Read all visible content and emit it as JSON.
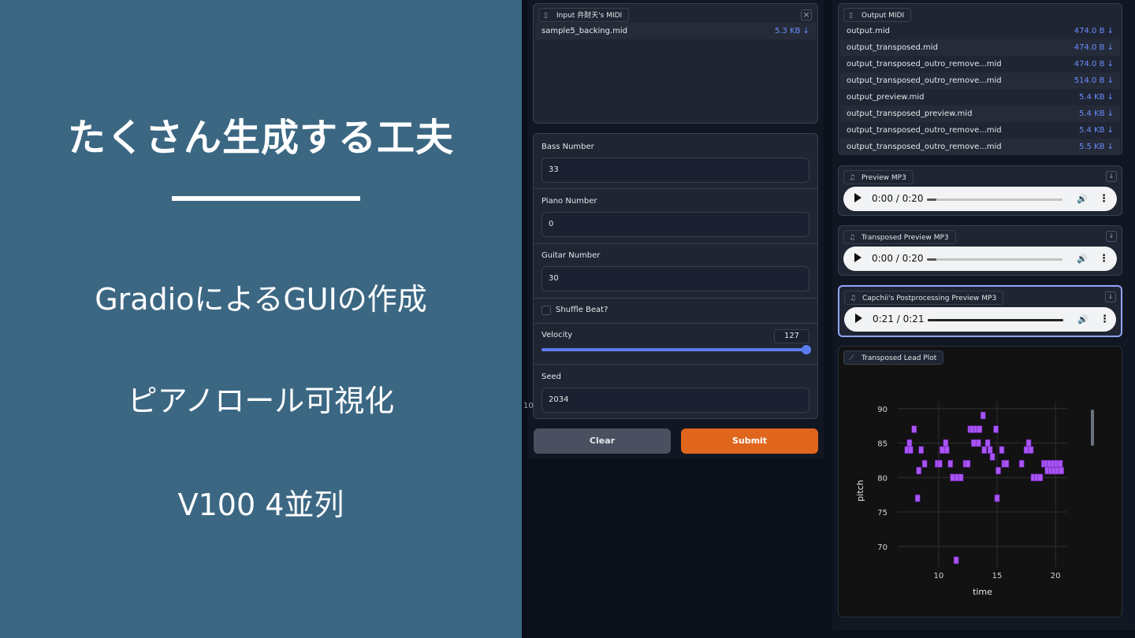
{
  "slide": {
    "title": "たくさん生成する工夫",
    "line1": "GradioによるGUIの作成",
    "line2": "ピアノロール可視化",
    "line3": "V100 4並列"
  },
  "input_midi": {
    "label": "Input 弁財天's MIDI",
    "file_name": "sample5_backing.mid",
    "file_size": "5.3 KB ↓",
    "close_icon": "×"
  },
  "form": {
    "bass": {
      "label": "Bass Number",
      "value": "33"
    },
    "piano": {
      "label": "Piano Number",
      "value": "0"
    },
    "guitar": {
      "label": "Guitar Number",
      "value": "30"
    },
    "shuffle": {
      "label": "Shuffle Beat?",
      "checked": false
    },
    "velocity": {
      "label": "Velocity",
      "value": "127",
      "fraction": 1.0
    },
    "seed": {
      "label": "Seed",
      "value": "2034"
    },
    "stray_number": "10",
    "clear_label": "Clear",
    "submit_label": "Submit"
  },
  "output_midi": {
    "label": "Output MIDI",
    "files": [
      {
        "name": "output.mid",
        "size": "474.0 B ↓"
      },
      {
        "name": "output_transposed.mid",
        "size": "474.0 B ↓"
      },
      {
        "name": "output_transposed_outro_remove...mid",
        "size": "474.0 B ↓"
      },
      {
        "name": "output_transposed_outro_remove...mid",
        "size": "514.0 B ↓"
      },
      {
        "name": "output_preview.mid",
        "size": "5.4 KB ↓"
      },
      {
        "name": "output_transposed_preview.mid",
        "size": "5.4 KB ↓"
      },
      {
        "name": "output_transposed_outro_remove...mid",
        "size": "5.4 KB ↓"
      },
      {
        "name": "output_transposed_outro_remove...mid",
        "size": "5.5 KB ↓"
      }
    ]
  },
  "audio": [
    {
      "label": "Preview MP3",
      "time": "0:00 / 0:20",
      "progress": 0.0,
      "focused": false
    },
    {
      "label": "Transposed Preview MP3",
      "time": "0:00 / 0:20",
      "progress": 0.0,
      "focused": false
    },
    {
      "label": "Capchii's Postprocessing Preview MP3",
      "time": "0:21 / 0:21",
      "progress": 1.0,
      "focused": true
    }
  ],
  "plot_label": "Transposed Lead Plot",
  "colors": {
    "accent": "#6b8cff",
    "submit": "#e0661e",
    "note": "#a855f7",
    "slide_bg": "#3b6783"
  },
  "chart_data": {
    "type": "scatter",
    "title": "",
    "xlabel": "time",
    "ylabel": "pitch",
    "x_ticks": [
      "10",
      "15",
      "20"
    ],
    "y_ticks": [
      "70",
      "75",
      "80",
      "85",
      "90"
    ],
    "xlim": [
      6.5,
      21
    ],
    "ylim": [
      67,
      91
    ],
    "grid": true,
    "notes": [
      {
        "x": 7.3,
        "y": 84
      },
      {
        "x": 7.5,
        "y": 85
      },
      {
        "x": 7.6,
        "y": 84
      },
      {
        "x": 7.9,
        "y": 87
      },
      {
        "x": 8.2,
        "y": 77
      },
      {
        "x": 8.3,
        "y": 81
      },
      {
        "x": 8.5,
        "y": 84
      },
      {
        "x": 8.8,
        "y": 82
      },
      {
        "x": 9.9,
        "y": 82
      },
      {
        "x": 10.1,
        "y": 82
      },
      {
        "x": 10.3,
        "y": 84
      },
      {
        "x": 10.6,
        "y": 85
      },
      {
        "x": 10.7,
        "y": 84
      },
      {
        "x": 11.0,
        "y": 82
      },
      {
        "x": 11.2,
        "y": 80
      },
      {
        "x": 11.5,
        "y": 68
      },
      {
        "x": 11.6,
        "y": 80
      },
      {
        "x": 11.9,
        "y": 80
      },
      {
        "x": 12.3,
        "y": 82
      },
      {
        "x": 12.5,
        "y": 82
      },
      {
        "x": 12.7,
        "y": 87
      },
      {
        "x": 12.9,
        "y": 87
      },
      {
        "x": 13.0,
        "y": 85
      },
      {
        "x": 13.2,
        "y": 87
      },
      {
        "x": 13.4,
        "y": 85
      },
      {
        "x": 13.5,
        "y": 87
      },
      {
        "x": 13.8,
        "y": 89
      },
      {
        "x": 13.9,
        "y": 84
      },
      {
        "x": 14.2,
        "y": 85
      },
      {
        "x": 14.4,
        "y": 84
      },
      {
        "x": 14.6,
        "y": 83
      },
      {
        "x": 14.9,
        "y": 87
      },
      {
        "x": 15.0,
        "y": 77
      },
      {
        "x": 15.1,
        "y": 81
      },
      {
        "x": 15.4,
        "y": 84
      },
      {
        "x": 15.6,
        "y": 82
      },
      {
        "x": 15.8,
        "y": 82
      },
      {
        "x": 17.1,
        "y": 82
      },
      {
        "x": 17.5,
        "y": 84
      },
      {
        "x": 17.7,
        "y": 85
      },
      {
        "x": 17.9,
        "y": 84
      },
      {
        "x": 18.1,
        "y": 80
      },
      {
        "x": 18.4,
        "y": 80
      },
      {
        "x": 18.7,
        "y": 80
      },
      {
        "x": 19.0,
        "y": 82
      },
      {
        "x": 19.2,
        "y": 82
      },
      {
        "x": 19.3,
        "y": 81
      },
      {
        "x": 19.5,
        "y": 82
      },
      {
        "x": 19.6,
        "y": 81
      },
      {
        "x": 19.8,
        "y": 82
      },
      {
        "x": 19.9,
        "y": 81
      },
      {
        "x": 20.1,
        "y": 82
      },
      {
        "x": 20.2,
        "y": 81
      },
      {
        "x": 20.4,
        "y": 82
      },
      {
        "x": 20.5,
        "y": 81
      }
    ]
  }
}
